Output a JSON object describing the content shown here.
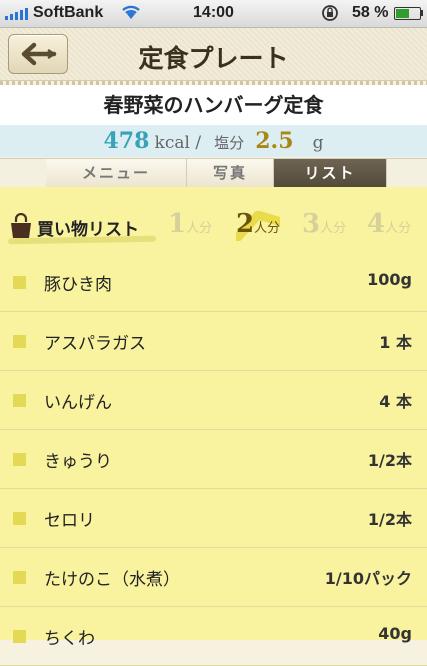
{
  "status_bar": {
    "carrier": "SoftBank",
    "time": "14:00",
    "battery_percent": "58 %",
    "battery_level": 0.58,
    "icons": [
      "signal-icon",
      "wifi-icon",
      "rotation-lock-icon",
      "battery-icon"
    ]
  },
  "navbar": {
    "title": "定食プレート",
    "back_icon": "arrow-left-icon"
  },
  "dish": {
    "name": "春野菜のハンバーグ定食",
    "kcal_value": "478",
    "kcal_unit": "kcal /",
    "salt_label": "塩分",
    "salt_value": "2.5",
    "salt_unit": "g"
  },
  "tabs": [
    {
      "label": "メニュー",
      "active": false
    },
    {
      "label": "写真",
      "active": false
    },
    {
      "label": "リスト",
      "active": true
    }
  ],
  "shopping": {
    "title": "買い物リスト",
    "icon": "shopping-bag-icon",
    "servings": [
      {
        "num": "1",
        "unit": "人分",
        "selected": false
      },
      {
        "num": "2",
        "unit": "人分",
        "selected": true
      },
      {
        "num": "3",
        "unit": "人分",
        "selected": false
      },
      {
        "num": "4",
        "unit": "人分",
        "selected": false
      }
    ],
    "items": [
      {
        "name": "豚ひき肉",
        "qty": "100g"
      },
      {
        "name": "アスパラガス",
        "qty": "1 本"
      },
      {
        "name": "いんげん",
        "qty": "4 本"
      },
      {
        "name": "きゅうり",
        "qty": "1/2本"
      },
      {
        "name": "セロリ",
        "qty": "1/2本"
      },
      {
        "name": "たけのこ（水煮）",
        "qty": "1/10パック"
      },
      {
        "name": "ちくわ",
        "qty": "40g"
      }
    ]
  },
  "colors": {
    "accent_kcal": "#38a3b8",
    "accent_salt": "#a88712",
    "list_background": "#f9f3a0",
    "active_tab": "#5f5544"
  }
}
